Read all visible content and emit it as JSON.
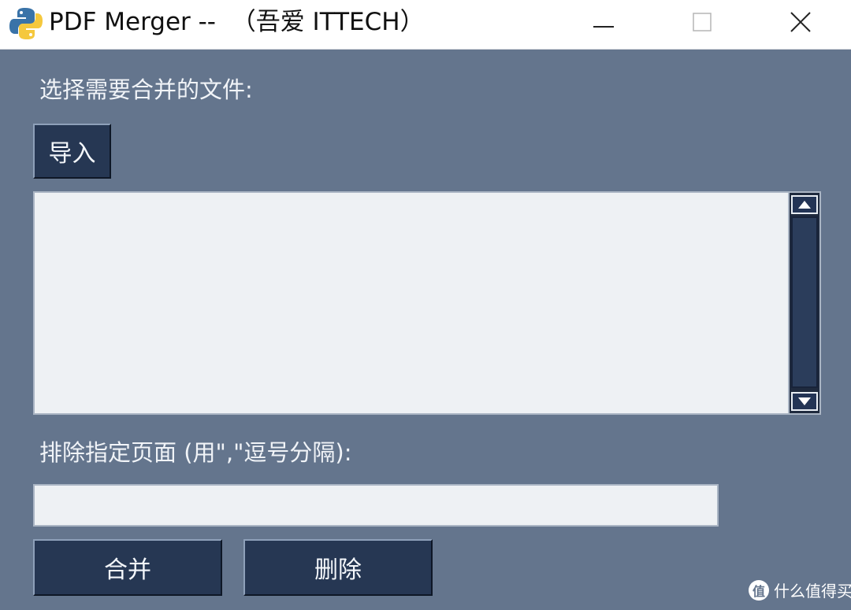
{
  "window": {
    "title": "PDF Merger --  （吾爱 ITTECH）"
  },
  "labels": {
    "select_files": "选择需要合并的文件:",
    "exclude_pages": "排除指定页面 (用\",\"逗号分隔):"
  },
  "buttons": {
    "import": "导入",
    "merge": "合并",
    "delete": "删除"
  },
  "file_list": {
    "items": []
  },
  "exclude_input": {
    "value": "",
    "placeholder": ""
  },
  "watermark": {
    "badge": "值",
    "text": "什么值得买"
  },
  "colors": {
    "window_bg": "#64758d",
    "button_bg": "#263753",
    "field_bg": "#eef1f4"
  },
  "icons": {
    "app": "python-icon",
    "minimize": "minimize-icon",
    "maximize": "maximize-icon",
    "close": "close-icon",
    "scroll_up": "arrow-up-icon",
    "scroll_down": "arrow-down-icon"
  }
}
